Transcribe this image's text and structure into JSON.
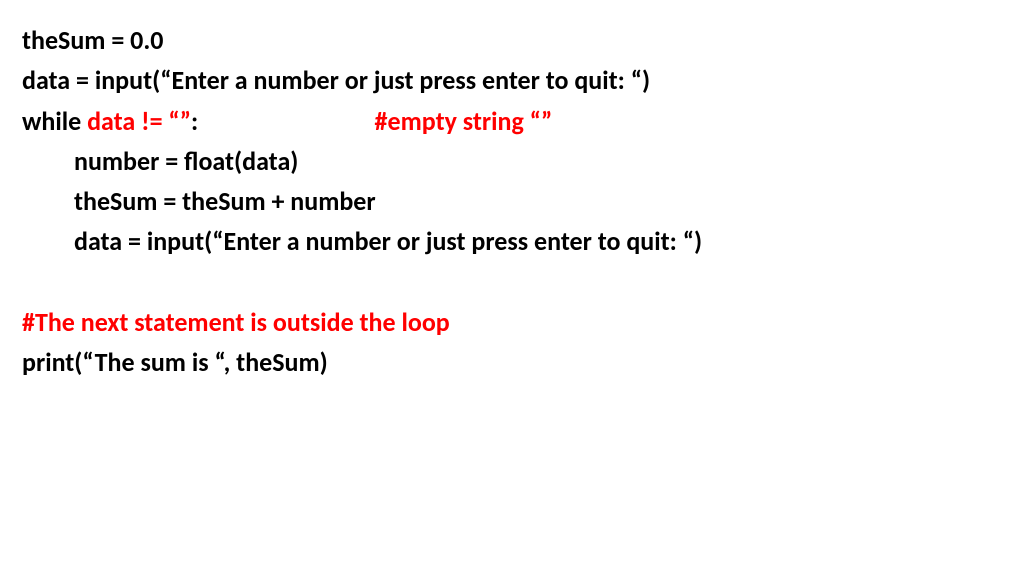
{
  "code": {
    "line1": "theSum = 0.0",
    "line2": "data = input(“Enter a number or just press enter to quit: “)",
    "line3_a": "while ",
    "line3_b": "data != “”",
    "line3_c": ":                              ",
    "line3_d": "#empty string “”",
    "line4": "number = float(data)",
    "line5": "theSum = theSum + number",
    "line6": "data = input(“Enter a number or just press enter to quit: “)",
    "line7": "#The next statement is outside the loop",
    "line8": "print(“The sum is “, theSum)"
  }
}
